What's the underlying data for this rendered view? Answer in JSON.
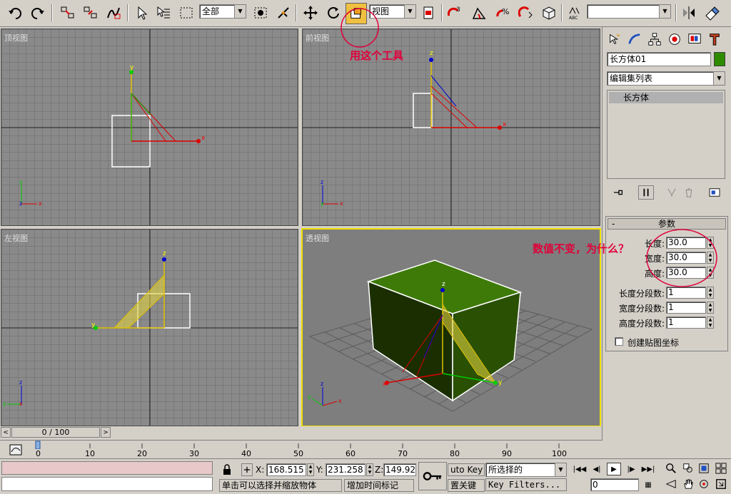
{
  "toolbar": {
    "selection_filter": "全部",
    "coord_system": "视图",
    "named_selection": ""
  },
  "viewports": {
    "top": "顶视图",
    "front": "前视图",
    "left": "左视图",
    "perspective": "透视图"
  },
  "axes": {
    "x": "x",
    "y": "y",
    "z": "z"
  },
  "annotations": {
    "tool_note": "用这个工具",
    "question": "数值不变，为什么？"
  },
  "command_panel": {
    "object_name": "长方体01",
    "object_color": "#2e8b00",
    "modifier_list": "编辑集列表",
    "stack_item": "长方体",
    "rollout_title": "参数",
    "rollout_toggle": "-",
    "params": [
      {
        "label": "长度:",
        "value": "30.0"
      },
      {
        "label": "宽度:",
        "value": "30.0"
      },
      {
        "label": "高度:",
        "value": "30.0"
      },
      {
        "label": "长度分段数:",
        "value": "1"
      },
      {
        "label": "宽度分段数:",
        "value": "1"
      },
      {
        "label": "高度分段数:",
        "value": "1"
      }
    ],
    "gen_map_coords": "创建贴图坐标"
  },
  "time_slider": {
    "position": "0 / 100"
  },
  "trackbar": {
    "ticks": [
      "0",
      "10",
      "20",
      "30",
      "40",
      "50",
      "60",
      "70",
      "80",
      "90",
      "100"
    ]
  },
  "status": {
    "x_label": "X:",
    "x_value": "168.515",
    "y_label": "Y:",
    "y_value": "231.258",
    "z_label": "Z:",
    "z_value": "149.92",
    "prompt": "单击可以选择并缩放物体",
    "add_time_tag": "增加时间标记",
    "auto_key": "uto Key",
    "set_key": "置关键",
    "key_mode": "所选择的",
    "key_filters": "Key Filters...",
    "frame": "0"
  }
}
